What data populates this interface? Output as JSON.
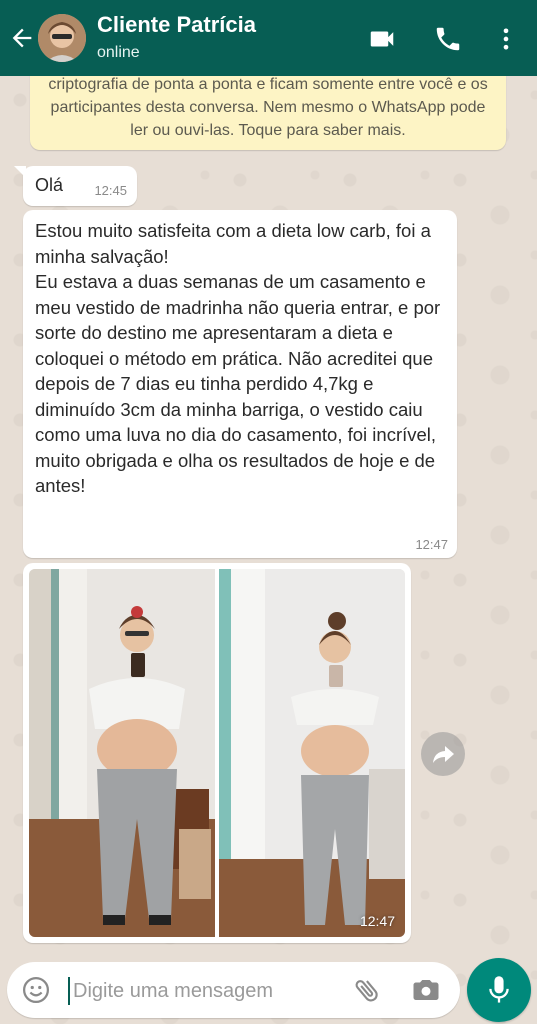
{
  "header": {
    "contact_name": "Cliente Patrícia",
    "status": "online",
    "icons": [
      "back-arrow-icon",
      "video-call-icon",
      "phone-icon",
      "more-vert-icon"
    ]
  },
  "encryption_notice": {
    "text": "As mensagens e as chamadas são protegidas com a criptografia de ponta a ponta e ficam somente entre você e os participantes desta conversa. Nem mesmo o WhatsApp pode ler ou ouvi-las. Toque para saber mais."
  },
  "messages": [
    {
      "text": "Olá",
      "time": "12:45"
    },
    {
      "text": "Estou muito satisfeita com a dieta low carb, foi a minha salvação!\nEu estava a duas semanas de um casamento e meu vestido de madrinha não queria entrar, e por sorte do destino me apresentaram a dieta e coloquei o método em prática. Não acreditei que depois de 7 dias eu tinha perdido 4,7kg e diminuído 3cm da minha barriga, o vestido caiu como uma luva no dia do casamento, foi incrível, muito obrigada e olha os resultados de hoje e de antes!",
      "time": "12:47"
    },
    {
      "type": "image",
      "description_icon": "before-after-photo",
      "time": "12:47"
    }
  ],
  "composer": {
    "placeholder": "Digite uma mensagem",
    "icons": [
      "emoji-icon",
      "attach-icon",
      "camera-icon",
      "mic-icon"
    ]
  },
  "colors": {
    "header": "#075e54",
    "notice_bg": "#fdf4c5",
    "mic_button": "#00897b",
    "bubble": "#ffffff"
  }
}
